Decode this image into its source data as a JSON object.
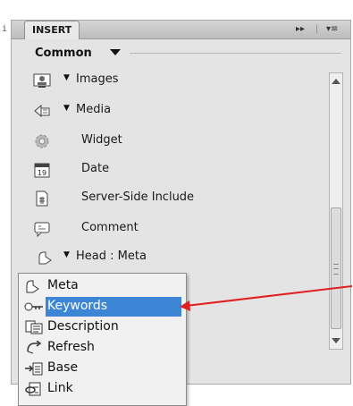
{
  "panel": {
    "tab_label": "INSERT",
    "header_controls": [
      "▸▸",
      "|",
      "▾≡"
    ],
    "category": "Common",
    "edge_mark": "i"
  },
  "items": [
    {
      "label": "Images",
      "icon": "image-icon",
      "has_dropdown": true
    },
    {
      "label": "Media",
      "icon": "media-icon",
      "has_dropdown": true
    },
    {
      "label": "Widget",
      "icon": "gear-icon",
      "has_dropdown": false
    },
    {
      "label": "Date",
      "icon": "calendar-icon",
      "icon_text": "19",
      "has_dropdown": false
    },
    {
      "label": "Server-Side Include",
      "icon": "server-include-icon",
      "has_dropdown": false
    },
    {
      "label": "Comment",
      "icon": "comment-icon",
      "has_dropdown": false
    },
    {
      "label": "Head : Meta",
      "icon": "head-icon",
      "has_dropdown": true
    }
  ],
  "menu": {
    "items": [
      {
        "label": "Meta",
        "icon": "head-icon"
      },
      {
        "label": "Keywords",
        "icon": "keywords-icon",
        "selected": true
      },
      {
        "label": "Description",
        "icon": "description-icon"
      },
      {
        "label": "Refresh",
        "icon": "refresh-icon"
      },
      {
        "label": "Base",
        "icon": "base-icon"
      },
      {
        "label": "Link",
        "icon": "link-icon"
      }
    ]
  },
  "colors": {
    "selection": "#3d86d6",
    "annotation_arrow": "#e02020",
    "panel_bg": "#e4e4e4"
  }
}
